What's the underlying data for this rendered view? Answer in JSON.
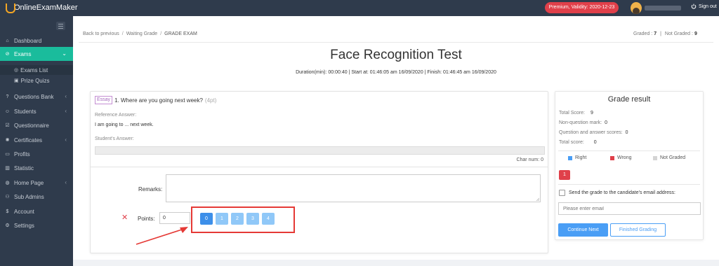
{
  "header": {
    "logo_text": "OnlineExamMaker",
    "premium_badge": "Premium, Validity: 2020-12-23",
    "signout_label": "Sign out"
  },
  "sidebar": {
    "items": [
      {
        "label": "Dashboard",
        "icon": "home-icon"
      },
      {
        "label": "Exams",
        "icon": "check-circle-icon"
      },
      {
        "label": "Questions Bank",
        "icon": "question-icon"
      },
      {
        "label": "Students",
        "icon": "user-icon"
      },
      {
        "label": "Questionnaire",
        "icon": "checkbox-icon"
      },
      {
        "label": "Certificates",
        "icon": "certificate-icon"
      },
      {
        "label": "Profits",
        "icon": "card-icon"
      },
      {
        "label": "Statistic",
        "icon": "bar-chart-icon"
      },
      {
        "label": "Home Page",
        "icon": "globe-icon"
      },
      {
        "label": "Sub Admins",
        "icon": "users-icon"
      },
      {
        "label": "Account",
        "icon": "dollar-icon"
      },
      {
        "label": "Settings",
        "icon": "gear-icon"
      }
    ],
    "exams_sub": [
      {
        "label": "Exams List"
      },
      {
        "label": "Prize Quizs"
      }
    ]
  },
  "breadcrumb": {
    "back": "Back to previous",
    "sep": "/",
    "waiting": "Waiting Grade",
    "current": "GRADE EXAM"
  },
  "stats": {
    "graded_label": "Graded :",
    "graded_value": "7",
    "not_graded_label": "Not Graded :",
    "not_graded_value": "9",
    "separator": "|"
  },
  "exam": {
    "title": "Face Recognition Test",
    "timing": "Duration(min): 00:00:40 | Start at: 01:46:05 am 16/09/2020 | Finish: 01:46:45 am 16/09/2020"
  },
  "question": {
    "type_tag": "Essay",
    "text": "1. Where are you going next week?",
    "points": "(4pt)",
    "reference_label": "Reference Answer:",
    "reference_answer": "I am going to ... next week.",
    "student_label": "Student's Answer:",
    "char_num": "Char num: 0",
    "remarks_label": "Remarks:",
    "points_label": "Points:",
    "points_value": "0",
    "point_options": [
      "0",
      "1",
      "2",
      "3",
      "4"
    ],
    "selected_point": "0"
  },
  "grade_result": {
    "title": "Grade result",
    "total_score_label": "Total Score:",
    "total_score": "9",
    "non_question_label": "Non-question mark:",
    "non_question": "0",
    "qa_scores_label": "Question and answer scores:",
    "qa_scores": "0",
    "total_label": "Total score:",
    "total": "0",
    "legend": [
      {
        "label": "Right",
        "color": "#4a9ef5"
      },
      {
        "label": "Wrong",
        "color": "#e0404a"
      },
      {
        "label": "Not Graded",
        "color": "#d4d4d4"
      }
    ],
    "question_numbers": [
      "1"
    ],
    "send_email_label": "Send the grade to the candidate's email address:",
    "email_placeholder": "Please enter email",
    "continue_button": "Continue Next",
    "finished_button": "Finished Grading"
  }
}
